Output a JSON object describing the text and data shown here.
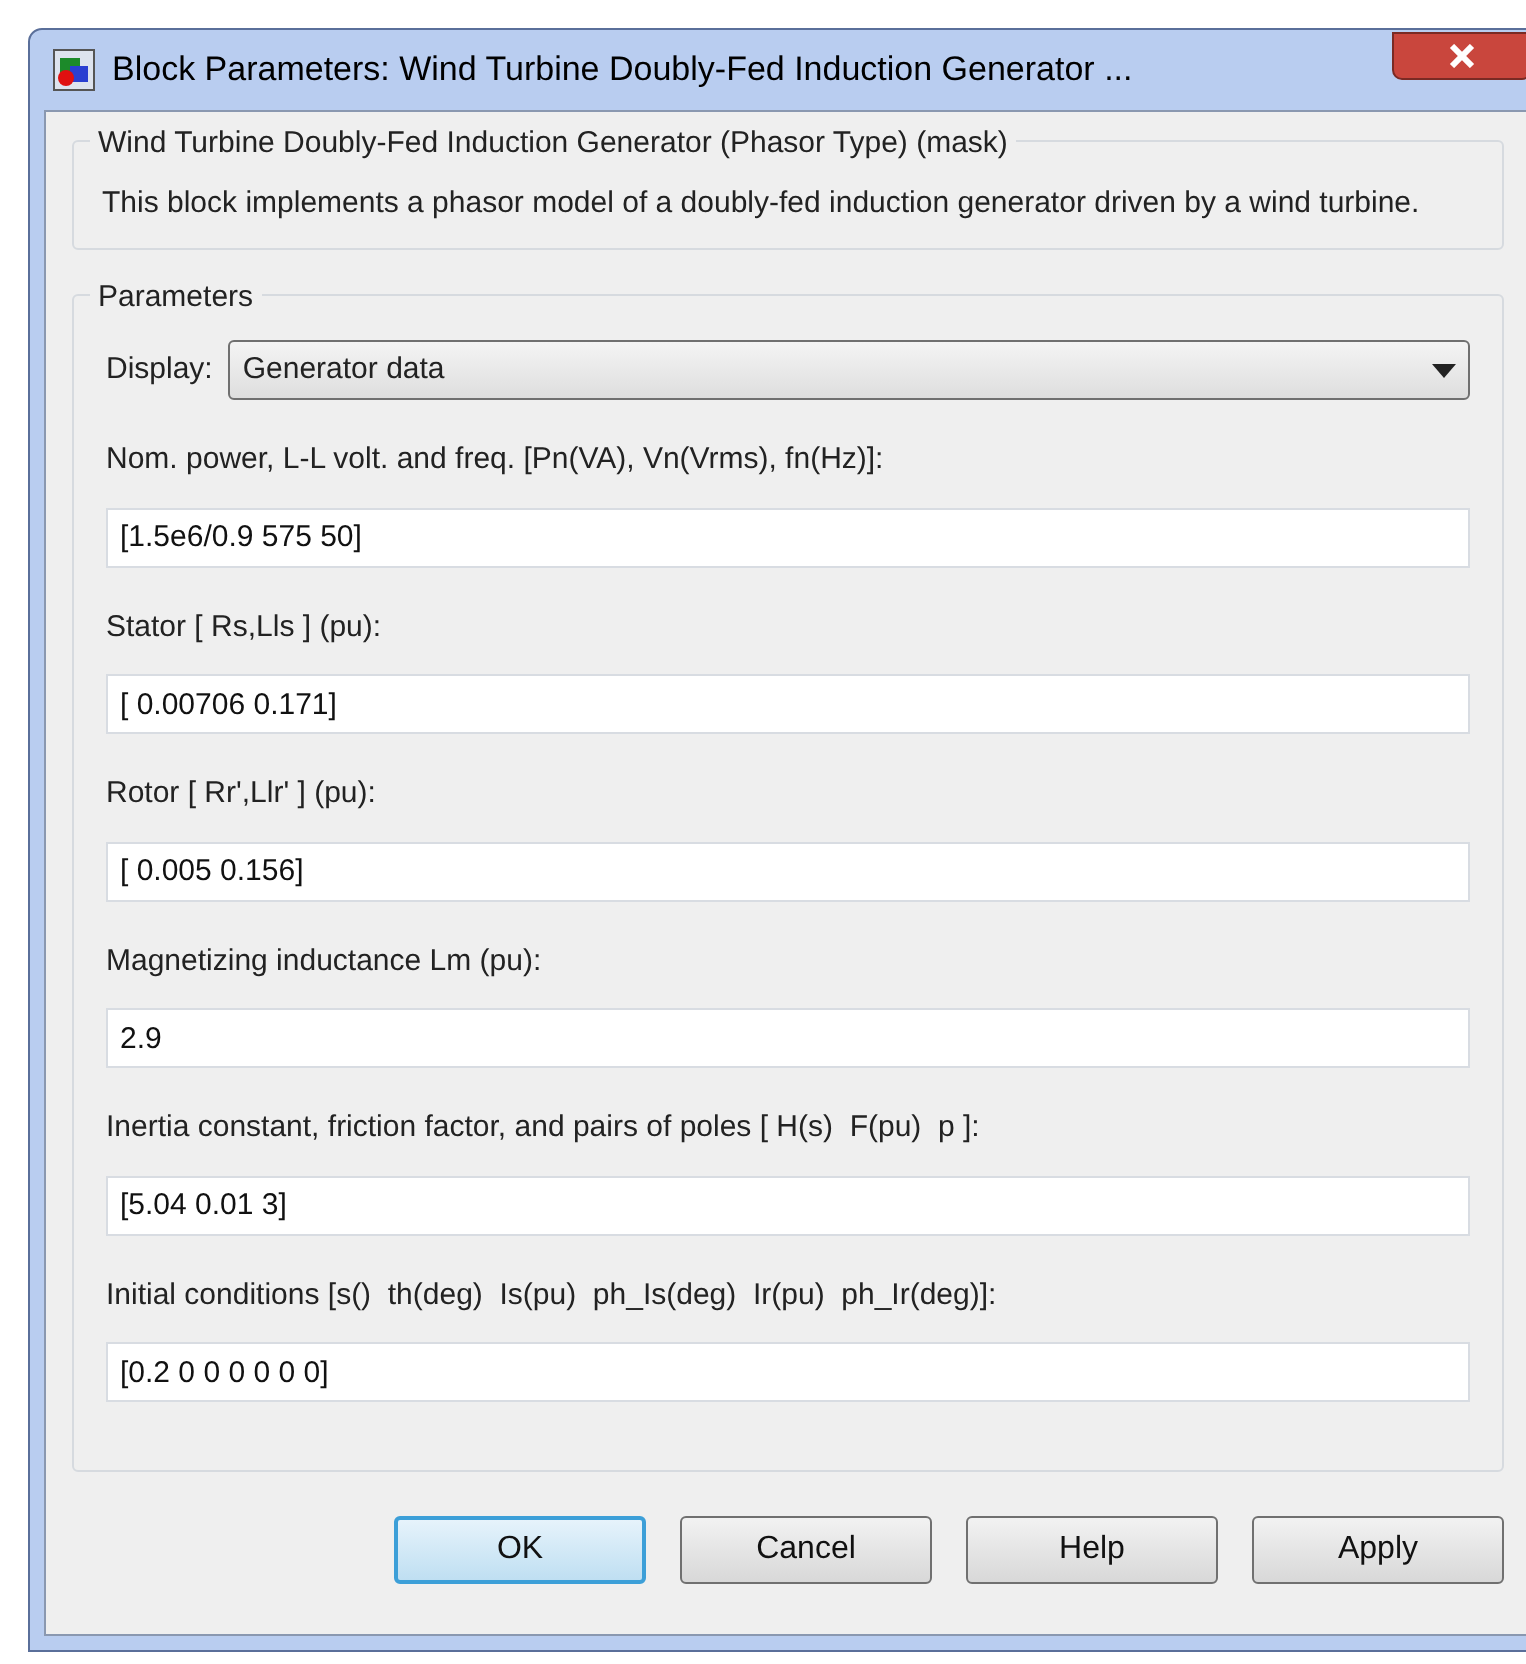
{
  "window": {
    "title": "Block Parameters: Wind Turbine Doubly-Fed Induction Generator ..."
  },
  "mask": {
    "title": "Wind Turbine Doubly-Fed Induction Generator (Phasor Type) (mask)",
    "description": "This block implements a phasor model of a doubly-fed induction generator driven by a wind turbine."
  },
  "parameters": {
    "title": "Parameters",
    "display": {
      "label": "Display:",
      "value": "Generator data"
    },
    "fields": [
      {
        "label": "Nom. power, L-L volt. and freq. [Pn(VA), Vn(Vrms), fn(Hz)]:",
        "value": "[1.5e6/0.9 575 50]"
      },
      {
        "label": "Stator [ Rs,Lls ] (pu):",
        "value": "[ 0.00706 0.171]"
      },
      {
        "label": "Rotor [ Rr',Llr' ] (pu):",
        "value": "[ 0.005 0.156]"
      },
      {
        "label": "Magnetizing inductance Lm (pu):",
        "value": "2.9"
      },
      {
        "label": "Inertia constant, friction factor, and pairs of poles [ H(s)  F(pu)  p ]:",
        "value": "[5.04 0.01 3]"
      },
      {
        "label": "Initial conditions [s()  th(deg)  Is(pu)  ph_Is(deg)  Ir(pu)  ph_Ir(deg)]:",
        "value": "[0.2 0 0 0 0 0 0]"
      }
    ]
  },
  "buttons": [
    {
      "label": "OK",
      "focused": true
    },
    {
      "label": "Cancel",
      "focused": false
    },
    {
      "label": "Help",
      "focused": false
    },
    {
      "label": "Apply",
      "focused": false
    }
  ]
}
